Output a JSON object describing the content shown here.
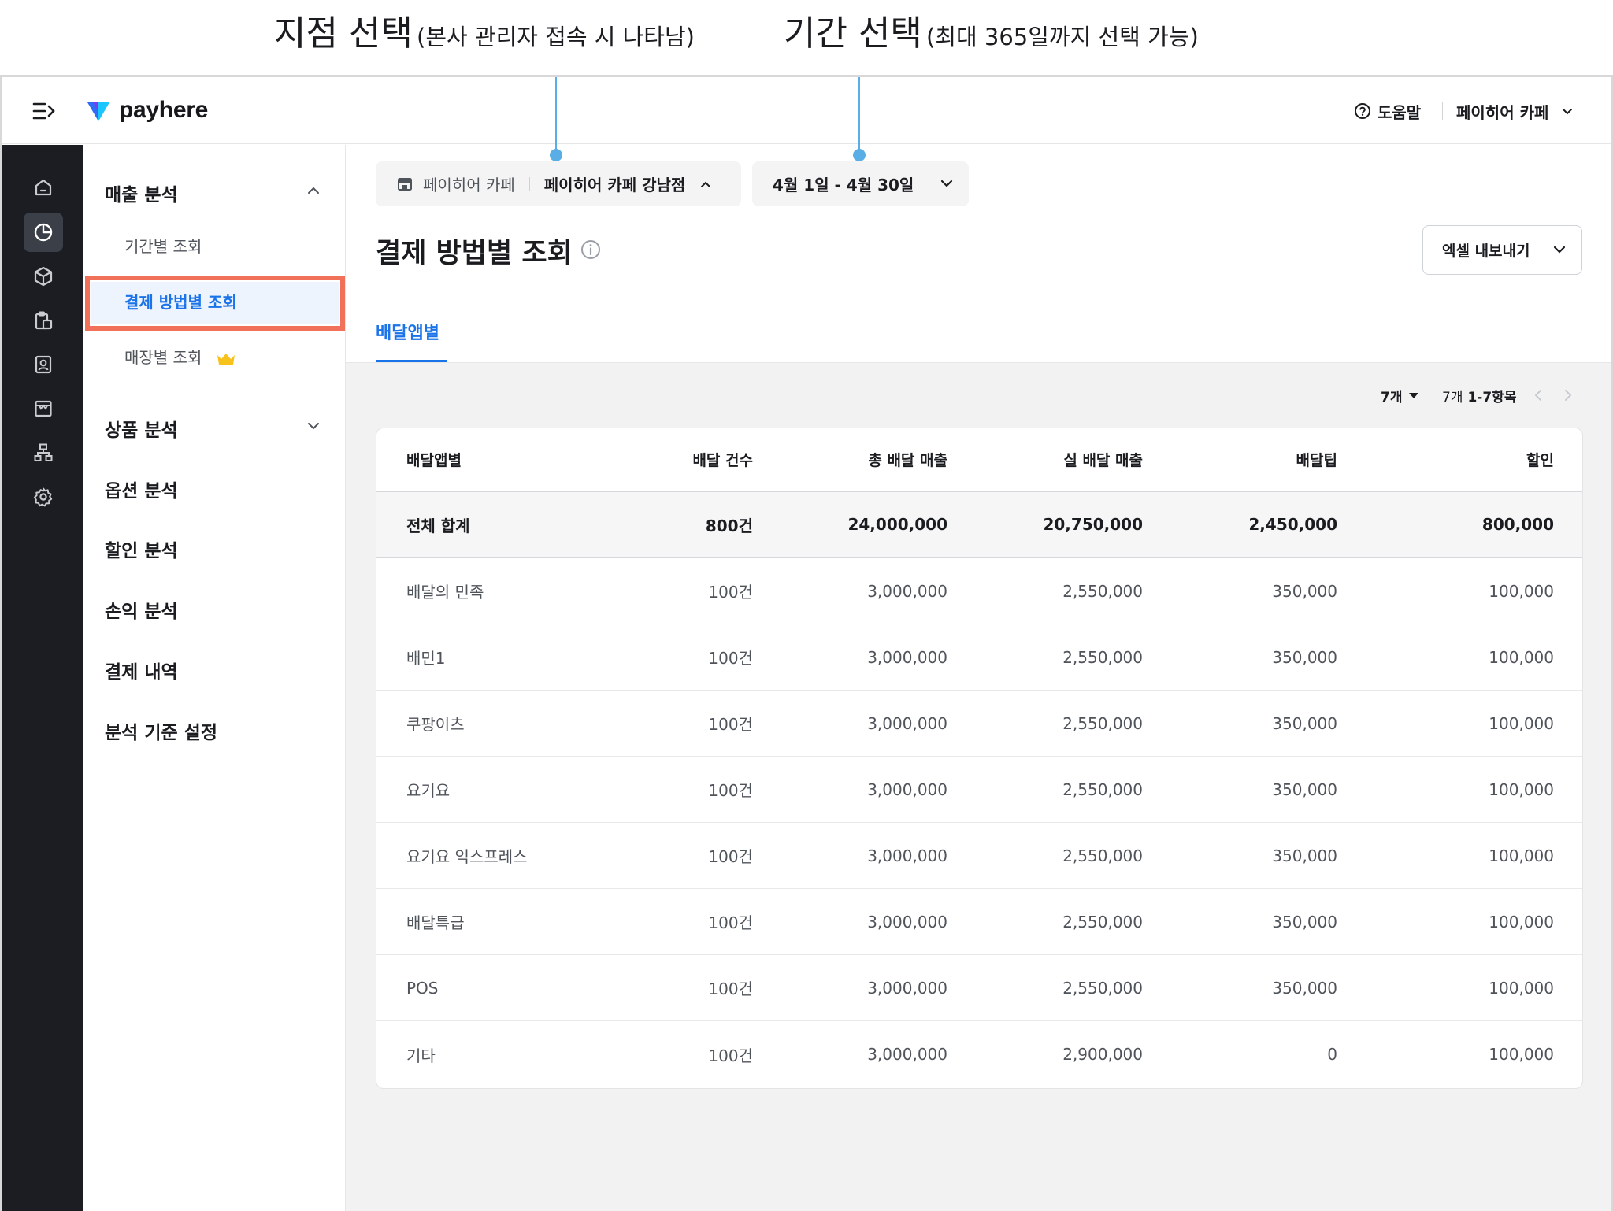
{
  "annotations": {
    "branch": {
      "title": "지점 선택",
      "note": "(본사 관리자 접속 시 나타남)"
    },
    "period": {
      "title": "기간 선택",
      "note": "(최대 365일까지 선택 가능)"
    }
  },
  "topbar": {
    "logo": "payhere",
    "help": "도움말",
    "account": "페이히어 카페"
  },
  "rail": {
    "icons": [
      "home-icon",
      "pie-chart-icon",
      "box-icon",
      "clipboard-icon",
      "person-card-icon",
      "store-icon",
      "org-chart-icon",
      "gear-icon"
    ],
    "active_index": 1
  },
  "sidebar": {
    "sales_analysis": "매출 분석",
    "sub_items": [
      "기간별 조회",
      "결제 방법별 조회",
      "매장별 조회"
    ],
    "active_sub": "결제 방법별 조회",
    "groups": [
      "상품 분석",
      "옵션 분석",
      "할인 분석",
      "손익 분석",
      "결제 내역",
      "분석 기준 설정"
    ]
  },
  "filters": {
    "branch_label": "페이히어 카페",
    "branch_value": "페이히어 카페 강남점",
    "period": "4월 1일 - 4월 30일"
  },
  "page": {
    "title": "결제 방법별 조회",
    "export": "엑셀 내보내기",
    "tab": "배달앱별"
  },
  "pager": {
    "page_size": "7개",
    "range_count": "7개",
    "range_items": "1-7항목"
  },
  "table": {
    "columns": [
      "배달앱별",
      "배달 건수",
      "총 배달 매출",
      "실 배달 매출",
      "배달팁",
      "할인"
    ],
    "total": [
      "전체 합계",
      "800건",
      "24,000,000",
      "20,750,000",
      "2,450,000",
      "800,000"
    ],
    "rows": [
      [
        "배달의 민족",
        "100건",
        "3,000,000",
        "2,550,000",
        "350,000",
        "100,000"
      ],
      [
        "배민1",
        "100건",
        "3,000,000",
        "2,550,000",
        "350,000",
        "100,000"
      ],
      [
        "쿠팡이츠",
        "100건",
        "3,000,000",
        "2,550,000",
        "350,000",
        "100,000"
      ],
      [
        "요기요",
        "100건",
        "3,000,000",
        "2,550,000",
        "350,000",
        "100,000"
      ],
      [
        "요기요 익스프레스",
        "100건",
        "3,000,000",
        "2,550,000",
        "350,000",
        "100,000"
      ],
      [
        "배달특급",
        "100건",
        "3,000,000",
        "2,550,000",
        "350,000",
        "100,000"
      ],
      [
        "POS",
        "100건",
        "3,000,000",
        "2,550,000",
        "350,000",
        "100,000"
      ],
      [
        "기타",
        "100건",
        "3,000,000",
        "2,900,000",
        "0",
        "100,000"
      ]
    ]
  },
  "colors": {
    "accent": "#1a73e8",
    "rail_bg": "#1b1d22",
    "highlight_border": "#f0705a",
    "annotation_pin": "#59aee6"
  }
}
